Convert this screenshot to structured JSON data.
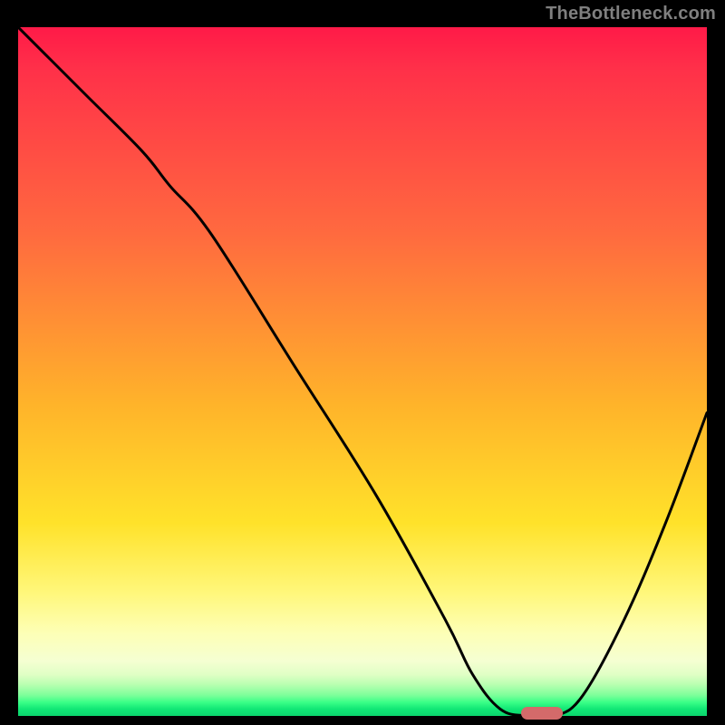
{
  "watermark": "TheBottleneck.com",
  "chart_data": {
    "type": "line",
    "title": "",
    "xlabel": "",
    "ylabel": "",
    "xlim": [
      0,
      100
    ],
    "ylim": [
      0,
      100
    ],
    "grid": false,
    "series": [
      {
        "name": "curve",
        "x": [
          0,
          4,
          10,
          18,
          22,
          28,
          40,
          52,
          62,
          66,
          70,
          74,
          78,
          82,
          88,
          94,
          100
        ],
        "y": [
          100,
          96,
          90,
          82,
          77,
          70,
          51,
          32,
          14,
          6,
          1,
          0,
          0,
          3,
          14,
          28,
          44
        ]
      }
    ],
    "marker": {
      "x": 76,
      "y": 0,
      "color": "#d46a6a"
    },
    "gradient_stops": [
      {
        "pos": 0,
        "color": "#ff1a48"
      },
      {
        "pos": 0.55,
        "color": "#ffb42a"
      },
      {
        "pos": 0.85,
        "color": "#fff77a"
      },
      {
        "pos": 1.0,
        "color": "#0bd46c"
      }
    ]
  }
}
